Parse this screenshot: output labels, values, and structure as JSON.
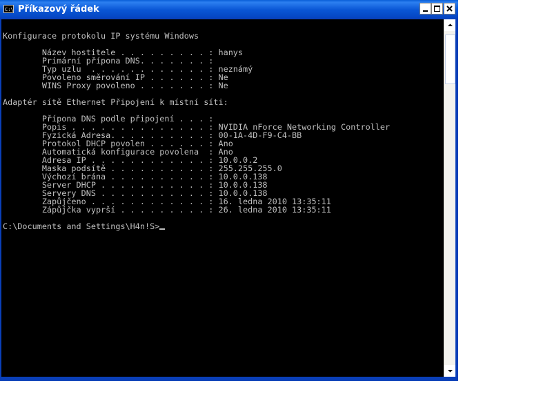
{
  "window": {
    "title": "Příkazový řádek",
    "icon_label": "C:\\",
    "controls": {
      "minimize": "minimize",
      "maximize": "maximize",
      "close": "close"
    }
  },
  "console": {
    "lines": [
      "",
      "Konfigurace protokolu IP systému Windows",
      "",
      "        Název hostitele . . . . . . . . . : hanys",
      "        Primární přípona DNS. . . . . . . :",
      "        Typ uzlu  . . . . . . . . . . . . : neznámý",
      "        Povoleno směrování IP . . . . . . : Ne",
      "        WINS Proxy povoleno . . . . . . . : Ne",
      "",
      "Adaptér sítě Ethernet Připojení k místní síti:",
      "",
      "        Přípona DNS podle připojení . . . :",
      "        Popis . . . . . . . . . . . . . . : NVIDIA nForce Networking Controller",
      "        Fyzická Adresa. . . . . . . . . . : 00-1A-4D-F9-C4-BB",
      "        Protokol DHCP povolen . . . . . . : Ano",
      "        Automatická konfigurace povolena  : Ano",
      "        Adresa IP . . . . . . . . . . . . : 10.0.0.2",
      "        Maska podsítě . . . . . . . . . . : 255.255.255.0",
      "        Výchozí brána . . . . . . . . . . : 10.0.0.138",
      "        Server DHCP . . . . . . . . . . . : 10.0.0.138",
      "        Servery DNS . . . . . . . . . . . : 10.0.0.138",
      "        Zapůjčeno . . . . . . . . . . . . : 16. ledna 2010 13:35:11",
      "        Zápůjčka vyprší . . . . . . . . . : 26. ledna 2010 13:35:11",
      "",
      "C:\\Documents and Settings\\H4n!S>"
    ]
  },
  "colors": {
    "console_text": "#c0c0c0",
    "console_background": "#000000",
    "titlebar": "#0a57d6",
    "close_button": "#e04a2a"
  },
  "icons": {
    "app": "cmd-icon",
    "minimize": "minimize-icon",
    "maximize": "maximize-icon",
    "close": "close-icon",
    "scroll_up": "chevron-up-icon",
    "scroll_down": "chevron-down-icon"
  }
}
